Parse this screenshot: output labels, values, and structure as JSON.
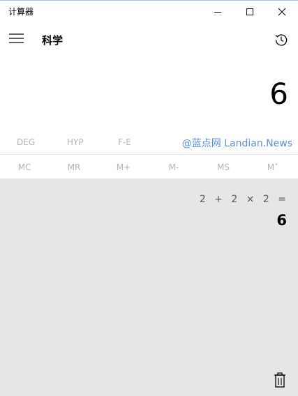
{
  "window": {
    "title": "计算器",
    "controls": [
      "minimize-icon",
      "maximize-icon",
      "close-icon"
    ]
  },
  "header": {
    "menu_icon": "hamburger-icon",
    "mode": "科学",
    "history_icon": "history-icon"
  },
  "display": {
    "value": "6"
  },
  "function_row": [
    "DEG",
    "HYP",
    "F-E"
  ],
  "memory_row": [
    "MC",
    "MR",
    "M+",
    "M-",
    "MS",
    "M˅"
  ],
  "watermark": "@蓝点网 Landian.News",
  "history": {
    "entries": [
      {
        "expression": "2 + 2 × 2 =",
        "result": "6"
      }
    ],
    "clear_icon": "trash-icon"
  },
  "colors": {
    "history_bg": "#e6e6e6",
    "disabled_text": "#b3b3b3",
    "watermark": "#5b8ed6"
  }
}
